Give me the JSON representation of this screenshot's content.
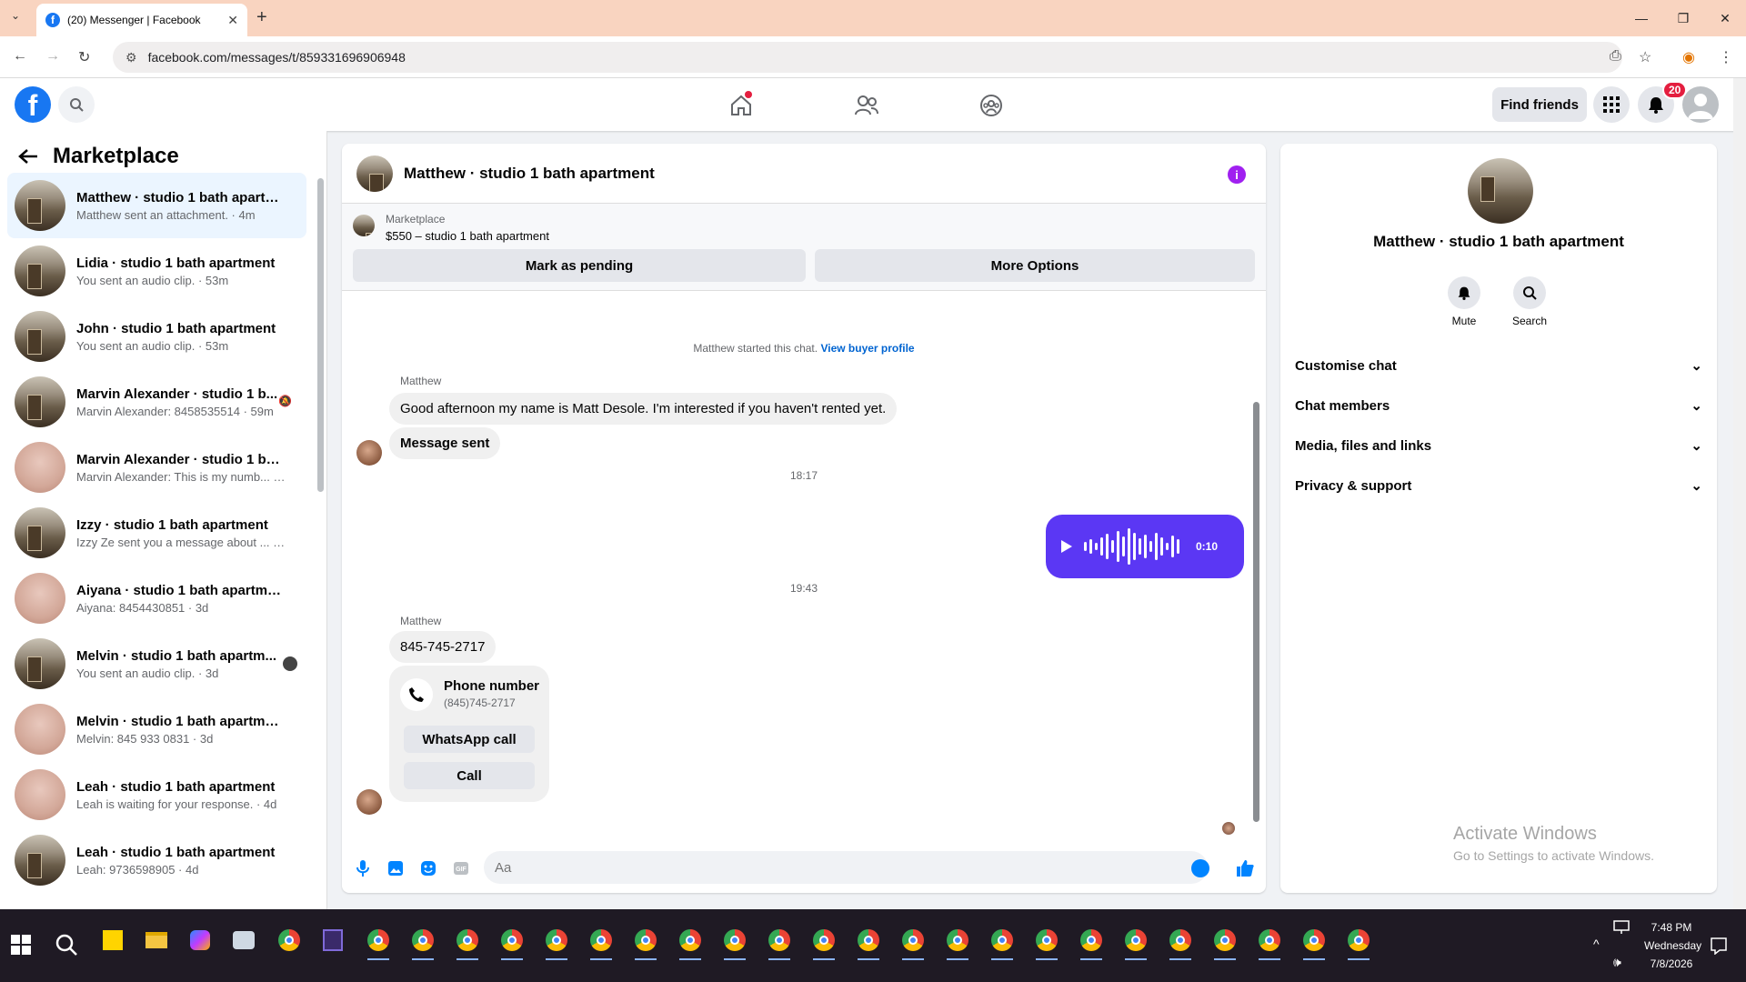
{
  "browser": {
    "tab_title": "(20) Messenger | Facebook",
    "url": "facebook.com/messages/t/859331696906948"
  },
  "fbnav": {
    "find_friends": "Find friends",
    "notification_count": "20"
  },
  "sidebar": {
    "title": "Marketplace",
    "conversations": [
      {
        "name": "Matthew · studio 1 bath apartm...",
        "sub": "Matthew sent an attachment. · 4m",
        "thumb": "kitchen",
        "active": true
      },
      {
        "name": "Lidia · studio 1 bath apartment",
        "sub": "You sent an audio clip. · 53m",
        "thumb": "kitchen"
      },
      {
        "name": "John · studio 1 bath apartment",
        "sub": "You sent an audio clip. · 53m",
        "thumb": "kitchen"
      },
      {
        "name": "Marvin Alexander · studio 1 b...",
        "sub": "Marvin Alexander: 8458535514 · 59m",
        "thumb": "kitchen",
        "muted": true
      },
      {
        "name": "Marvin Alexander · studio 1 bath...",
        "sub": "Marvin Alexander: This is my numb... · 1h",
        "thumb": "room"
      },
      {
        "name": "Izzy · studio 1 bath apartment",
        "sub": "Izzy Ze sent you a message about ... · 22h",
        "thumb": "kitchen"
      },
      {
        "name": "Aiyana · studio 1 bath apartment",
        "sub": "Aiyana: 8454430851 · 3d",
        "thumb": "room"
      },
      {
        "name": "Melvin · studio 1 bath apartm...",
        "sub": "You sent an audio clip. · 3d",
        "thumb": "kitchen",
        "seen": true
      },
      {
        "name": "Melvin · studio 1 bath apartment",
        "sub": "Melvin: 845 933 0831 · 3d",
        "thumb": "room"
      },
      {
        "name": "Leah · studio 1 bath apartment",
        "sub": "Leah is waiting for your response. · 4d",
        "thumb": "room"
      },
      {
        "name": "Leah · studio 1 bath apartment",
        "sub": "Leah: 9736598905 · 4d",
        "thumb": "kitchen"
      }
    ]
  },
  "chat": {
    "title": "Matthew · studio 1 bath apartment",
    "marketplace_label": "Marketplace",
    "listing": "$550 – studio 1 bath apartment",
    "mark_pending": "Mark as pending",
    "more_options": "More Options",
    "started_text": "Matthew started this chat.",
    "view_buyer": "View buyer profile",
    "sender1": "Matthew",
    "msg1": "Good afternoon my name is Matt Desole. I'm interested if you haven't rented yet.",
    "msg2": "Message sent",
    "time1": "18:17",
    "audio_duration": "0:10",
    "time2": "19:43",
    "sender2": "Matthew",
    "msg3": "845-745-2717",
    "card_label": "Phone number",
    "card_value": "(845)745-2717",
    "whatsapp": "WhatsApp call",
    "call": "Call",
    "input_placeholder": "Aa"
  },
  "info_panel": {
    "name": "Matthew · studio 1 bath apartment",
    "mute": "Mute",
    "search": "Search",
    "sections": [
      "Customise chat",
      "Chat members",
      "Media, files and links",
      "Privacy & support"
    ]
  },
  "watermark": {
    "line1": "Activate Windows",
    "line2": "Go to Settings to activate Windows."
  },
  "taskbar": {
    "time": "7:48 PM",
    "day": "Wednesday",
    "date": "7/8/2026"
  }
}
